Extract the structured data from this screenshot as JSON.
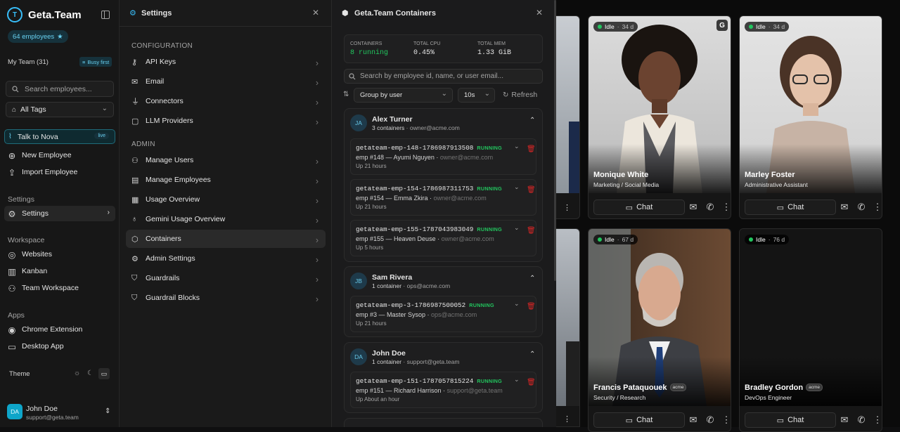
{
  "sidebar": {
    "brand": "Geta.Team",
    "employees_badge": "64 employees",
    "my_team_label": "My Team (31)",
    "busy_first_label": "Busy first",
    "search_placeholder": "Search employees...",
    "tags_label": "All Tags",
    "talk_label": "Talk to Nova",
    "live_badge": "live",
    "new_employee": "New Employee",
    "import_employee": "Import Employee",
    "settings_section": "Settings",
    "settings_item": "Settings",
    "workspace_section": "Workspace",
    "websites": "Websites",
    "kanban": "Kanban",
    "team_workspace": "Team Workspace",
    "apps_section": "Apps",
    "chrome_extension": "Chrome Extension",
    "desktop_app": "Desktop App",
    "theme_label": "Theme",
    "user": {
      "initials": "DA",
      "name": "John Doe",
      "email": "support@geta.team"
    }
  },
  "settings": {
    "title": "Settings",
    "configuration_section": "CONFIGURATION",
    "config_items": [
      "API Keys",
      "Email",
      "Connectors",
      "LLM Providers"
    ],
    "admin_section": "ADMIN",
    "admin_items": [
      "Manage Users",
      "Manage Employees",
      "Usage Overview",
      "Gemini Usage Overview",
      "Containers",
      "Admin Settings",
      "Guardrails",
      "Guardrail Blocks"
    ],
    "active_item": "Containers"
  },
  "containers": {
    "title": "Geta.Team Containers",
    "stats": {
      "containers_label": "CONTAINERS",
      "containers_value": "8 running",
      "cpu_label": "TOTAL CPU",
      "cpu_value": "0.45%",
      "mem_label": "TOTAL MEM",
      "mem_value": "1.33 GiB"
    },
    "search_placeholder": "Search by employee id, name, or user email...",
    "group_by": "Group by user",
    "interval": "10s",
    "refresh_label": "Refresh",
    "groups": [
      {
        "initials": "JA",
        "name": "Alex Turner",
        "summary": "3 containers",
        "email": "owner@acme.com",
        "containers": [
          {
            "id": "getateam-emp-148-1786987913508",
            "status": "RUNNING",
            "emp": "emp #148 — Ayumi Nguyen",
            "email": "owner@acme.com",
            "uptime": "Up 21 hours"
          },
          {
            "id": "getateam-emp-154-1786987311753",
            "status": "RUNNING",
            "emp": "emp #154 — Emma Zkira",
            "email": "owner@acme.com",
            "uptime": "Up 21 hours"
          },
          {
            "id": "getateam-emp-155-1787043983049",
            "status": "RUNNING",
            "emp": "emp #155 — Heaven Deuse",
            "email": "owner@acme.com",
            "uptime": "Up 5 hours"
          }
        ]
      },
      {
        "initials": "JB",
        "name": "Sam Rivera",
        "summary": "1 container",
        "email": "ops@acme.com",
        "containers": [
          {
            "id": "getateam-emp-3-1786987500052",
            "status": "RUNNING",
            "emp": "emp #3 — Master Sysop",
            "email": "ops@acme.com",
            "uptime": "Up 21 hours"
          }
        ]
      },
      {
        "initials": "DA",
        "name": "John Doe",
        "summary": "1 container",
        "email": "support@geta.team",
        "containers": [
          {
            "id": "getateam-emp-151-1787057815224",
            "status": "RUNNING",
            "emp": "emp #151 — Richard Harrison",
            "email": "support@geta.team",
            "uptime": "Up About an hour"
          }
        ]
      },
      {
        "initials": "",
        "name": "…...",
        "summary": "",
        "email": "",
        "containers": []
      }
    ]
  },
  "employees": [
    {
      "status": "Idle",
      "days": "34 d",
      "name": "Monique White",
      "role": "Marketing / Social Media",
      "tag": "",
      "chat": "Chat"
    },
    {
      "status": "Idle",
      "days": "34 d",
      "name": "Marley Foster",
      "role": "Administrative Assistant",
      "tag": "",
      "chat": "Chat"
    },
    {
      "status": "Idle",
      "days": "67 d",
      "name": "Francis Pataquouek",
      "role": "Security / Research",
      "tag": "acme",
      "chat": "Chat"
    },
    {
      "status": "Idle",
      "days": "76 d",
      "name": "Bradley Gordon",
      "role": "DevOps Engineer",
      "tag": "acme",
      "chat": "Chat"
    }
  ],
  "colors": {
    "accent": "#22c55e",
    "brand": "#38bdf8",
    "danger": "#dc2626"
  }
}
